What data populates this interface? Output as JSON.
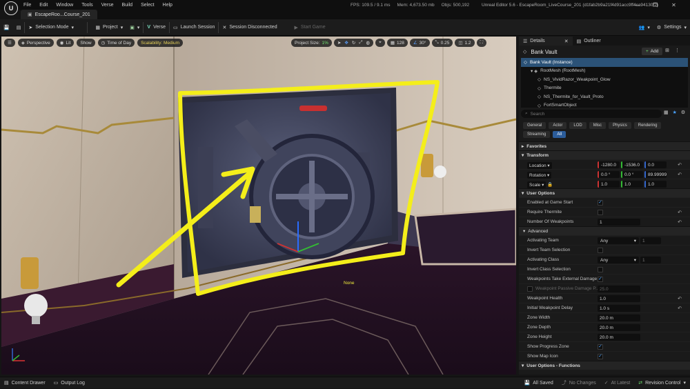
{
  "menu": [
    "File",
    "Edit",
    "Window",
    "Tools",
    "Verse",
    "Build",
    "Select",
    "Help"
  ],
  "stats": {
    "fps": "FPS: 109.5",
    "ms": "/ 9.1 ms",
    "mem": "Mem: 4,673.50 mb",
    "objs": "Objs: 500,192"
  },
  "window_title": "Unreal Editor 5.6 - EscapeRoom_LiveCourse_201 (d1fab2b9a21f4d91acc9ff4ca94130f2)",
  "project_tab": "EscapeRoo...Course_201",
  "toolbar": {
    "selection_mode": "Selection Mode",
    "project": "Project",
    "verse": "Verse",
    "launch_session": "Launch Session",
    "session_status": "Session Disconnected",
    "start_game": "Start Game",
    "settings": "Settings"
  },
  "viewport": {
    "perspective": "Perspective",
    "lit": "Lit",
    "show": "Show",
    "time_of_day": "Time of Day",
    "scalability": "Scalability: Medium",
    "project_size": "Project Size:",
    "project_size_pct": "1%",
    "grid_value": "128",
    "angle_value": "30°",
    "scale_value": "0.25",
    "cam_speed": "1.2",
    "none_label": "None"
  },
  "panel": {
    "tab_details": "Details",
    "tab_outliner": "Outliner",
    "actor_name": "Bank Vault",
    "add_label": "Add",
    "search_placeholder": "Search",
    "tree": [
      {
        "label": "Bank Vault (Instance)",
        "indent": 0,
        "selected": true
      },
      {
        "label": "RootMesh (RootMesh)",
        "indent": 1,
        "selected": false
      },
      {
        "label": "NS_VividRazor_Weakpoint_Glow",
        "indent": 2,
        "selected": false
      },
      {
        "label": "Thermite",
        "indent": 2,
        "selected": false
      },
      {
        "label": "NS_Thermite_for_Vault_Proto",
        "indent": 2,
        "selected": false
      },
      {
        "label": "FortSmartObject",
        "indent": 2,
        "selected": false
      }
    ],
    "filters": [
      "General",
      "Actor",
      "LOD",
      "Misc",
      "Physics",
      "Rendering",
      "Streaming",
      "All"
    ],
    "active_filter": "All"
  },
  "properties": {
    "favorites": "Favorites",
    "transform": "Transform",
    "location_label": "Location",
    "location": [
      "-1280.0",
      "-1536.0",
      "0.0"
    ],
    "rotation_label": "Rotation",
    "rotation": [
      "0.0 °",
      "0.0 °",
      "89.99999"
    ],
    "scale_label": "Scale",
    "scale": [
      "1.0",
      "1.0",
      "1.0"
    ],
    "user_options": "User Options",
    "enabled_at_game_start": "Enabled at Game Start",
    "require_thermite": "Require Thermite",
    "number_of_weakpoints": "Number Of Weakpoints",
    "number_of_weakpoints_value": "1",
    "advanced": "Advanced",
    "activating_team": "Activating Team",
    "activating_team_value": "Any",
    "activating_team_num": "1",
    "invert_team_selection": "Invert Team Selection",
    "activating_class": "Activating Class",
    "activating_class_value": "Any",
    "activating_class_num": "1",
    "invert_class_selection": "Invert Class Selection",
    "weakpoints_take_external_damage": "Weakpoints Take External Damage",
    "weakpoint_passive_damage": "Weakpoint Passive Damage P...",
    "weakpoint_passive_damage_value": "25.0",
    "weakpoint_health": "Weakpoint Health",
    "weakpoint_health_value": "1.0",
    "initial_weakpoint_delay": "Initial Weakpoint Delay",
    "initial_weakpoint_delay_value": "1.0 s",
    "zone_width": "Zone Width",
    "zone_width_value": "20.0 m",
    "zone_depth": "Zone Depth",
    "zone_depth_value": "20.0 m",
    "zone_height": "Zone Height",
    "zone_height_value": "20.0 m",
    "show_progress_zone": "Show Progress Zone",
    "show_map_icon": "Show Map Icon",
    "user_options_functions": "User Options - Functions"
  },
  "status": {
    "content_drawer": "Content Drawer",
    "output_log": "Output Log",
    "all_saved": "All Saved",
    "no_changes": "No Changes",
    "at_latest": "At Latest",
    "revision_control": "Revision Control"
  },
  "colors": {
    "accent": "#2b5c9a",
    "selection": "#2b5277",
    "annotation": "#f4ee1a",
    "scalability": "#e7d25a"
  }
}
